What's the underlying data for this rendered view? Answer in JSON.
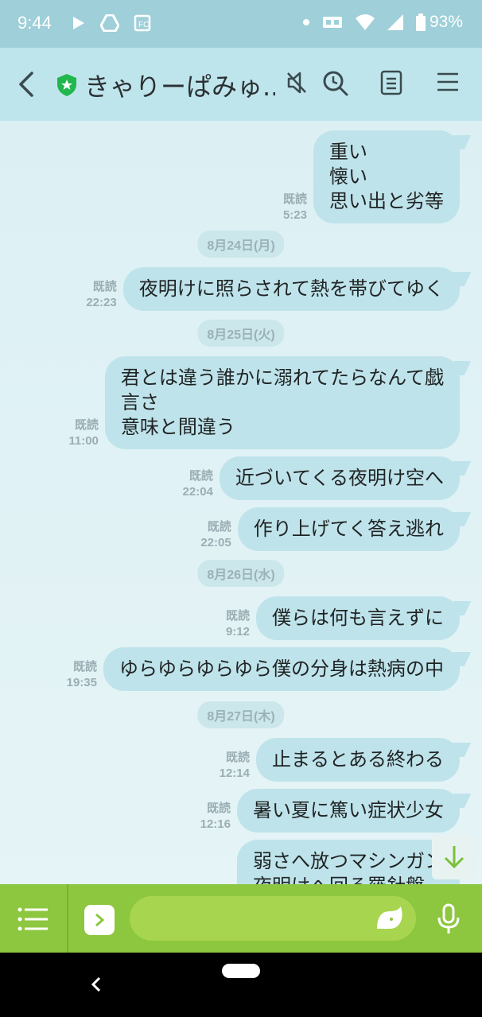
{
  "status_bar": {
    "time": "9:44",
    "battery": "93%",
    "icons": [
      "play-icon",
      "drive-icon",
      "app-icon",
      "dot-icon",
      "vpn-icon",
      "wifi-icon",
      "signal-icon",
      "battery-icon"
    ]
  },
  "header": {
    "title": "きゃりーぱみゅ...",
    "icons": [
      "back-icon",
      "shield-icon",
      "mute-icon",
      "search-icon",
      "notes-icon",
      "menu-icon"
    ]
  },
  "colors": {
    "header_bg": "#bfe5ec",
    "chat_bg": "#dcf0f4",
    "bubble": "#bfe3ea",
    "input_bar": "#8dc63f",
    "status_bar": "#9fcfd9"
  },
  "messages": [
    {
      "read": "既読",
      "time": "5:23",
      "text": "重い\n懐い\n思い出と劣等"
    },
    {
      "date": "8月24日(月)"
    },
    {
      "read": "既読",
      "time": "22:23",
      "text": "夜明けに照らされて熱を帯びてゆく"
    },
    {
      "date": "8月25日(火)"
    },
    {
      "read": "既読",
      "time": "11:00",
      "text": "君とは違う誰かに溺れてたらなんて戯\n言さ\n意味と間違う"
    },
    {
      "read": "既読",
      "time": "22:04",
      "text": "近づいてくる夜明け空へ"
    },
    {
      "read": "既読",
      "time": "22:05",
      "text": "作り上げてく答え逃れ"
    },
    {
      "date": "8月26日(水)"
    },
    {
      "read": "既読",
      "time": "9:12",
      "text": "僕らは何も言えずに"
    },
    {
      "read": "既読",
      "time": "19:35",
      "text": "ゆらゆらゆらゆら僕の分身は熱病の中"
    },
    {
      "date": "8月27日(木)"
    },
    {
      "read": "既読",
      "time": "12:14",
      "text": "止まるとある終わる"
    },
    {
      "read": "既読",
      "time": "12:16",
      "text": "暑い夏に篤い症状少女"
    },
    {
      "text": "弱さへ放つマシンガン\n夜明けへ回る羅針盤"
    }
  ],
  "input": {
    "value": "",
    "placeholder": ""
  }
}
